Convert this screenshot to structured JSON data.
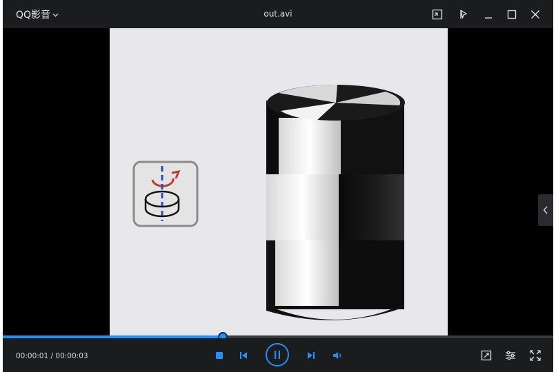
{
  "app": {
    "name": "QQ影音",
    "menu_chevron": "chevron-down-icon"
  },
  "window": {
    "file_title": "out.avi"
  },
  "titlebar_buttons": [
    "mini-mode-icon",
    "pin-icon",
    "minimize-icon",
    "maximize-icon",
    "close-icon"
  ],
  "playback": {
    "current_time": "00:00:01",
    "separator": " / ",
    "total_time": "00:00:03",
    "progress_fraction": 0.4,
    "state": "playing"
  },
  "controls": {
    "left": [
      "stop-icon",
      "previous-icon"
    ],
    "center": "pause-icon",
    "right": [
      "next-icon",
      "volume-icon"
    ],
    "tools": [
      "screenshot-tool-icon",
      "settings-sliders-icon",
      "fullscreen-icon"
    ]
  },
  "colors": {
    "accent": "#1e90ff",
    "background": "#1b1c1e",
    "video_bg": "#000000"
  }
}
